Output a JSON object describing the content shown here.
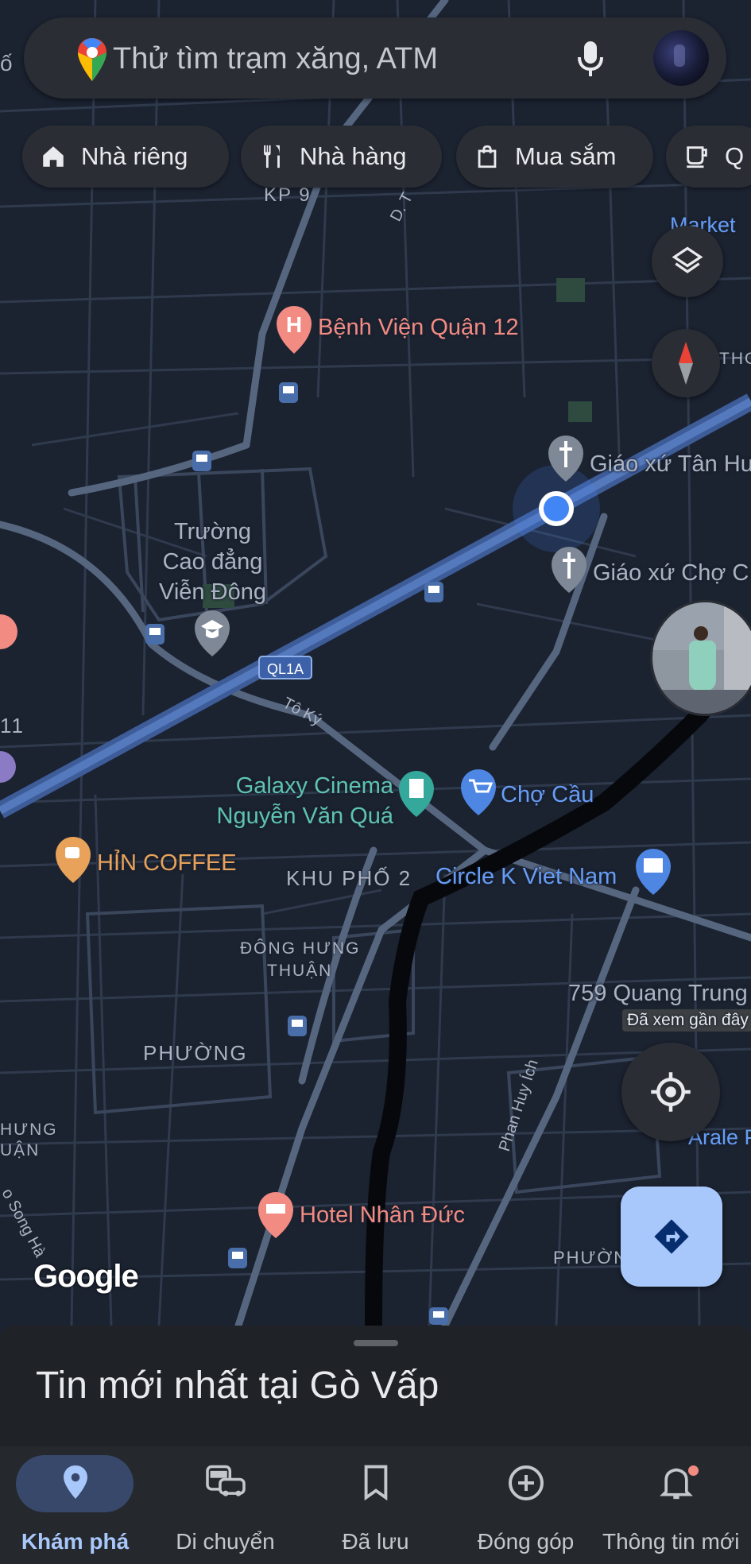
{
  "search": {
    "placeholder": "Thử tìm trạm xăng, ATM"
  },
  "chips": [
    {
      "label": "Nhà riêng",
      "icon": "home-icon"
    },
    {
      "label": "Nhà hàng",
      "icon": "restaurant-icon"
    },
    {
      "label": "Mua sắm",
      "icon": "shopping-bag-icon"
    },
    {
      "label": "Q",
      "icon": "coffee-icon"
    }
  ],
  "map": {
    "pois": [
      {
        "name": "Bệnh Viện Quận 12",
        "color": "#f28b82"
      },
      {
        "name": "Giáo xứ Tân Hu",
        "color": "#aab3c2"
      },
      {
        "name": "Giáo xứ Chợ C",
        "color": "#aab3c2"
      },
      {
        "name": "Trường Cao đẳng Viễn Đông",
        "lines": [
          "Trường",
          "Cao đẳng",
          "Viễn Đông"
        ],
        "color": "#aab3c2"
      },
      {
        "name": "Galaxy Cinema Nguyễn Văn Quá",
        "lines": [
          "Galaxy Cinema",
          "Nguyễn Văn Quá"
        ],
        "color": "#5ec3b0"
      },
      {
        "name": "Chợ Cầu",
        "color": "#669df6"
      },
      {
        "name": "HỈN COFFEE",
        "color": "#e8a25a"
      },
      {
        "name": "Circle K Viet Nam",
        "color": "#669df6"
      },
      {
        "name": "759 Quang Trung",
        "color": "#aab3c2"
      },
      {
        "name": "Hotel Nhân Đức",
        "color": "#f28b82"
      },
      {
        "name": "Market",
        "color": "#669df6"
      },
      {
        "name": "Arale Pe",
        "color": "#669df6"
      }
    ],
    "areas": [
      "KP 9",
      "KHU PHỐ 2",
      "ĐÔNG HƯNG",
      "THUẬN",
      "PHƯỜNG",
      "PHƯỜN",
      "HƯNG",
      "UẬN",
      "THO"
    ],
    "roads": [
      "QL1A",
      "Tô Ký",
      "Phan Huy Ích",
      "D. T",
      "o Song Hà"
    ],
    "recently_viewed": "Đã xem gần đây",
    "edge_labels": [
      "ố",
      "11"
    ],
    "google_logo": "Google"
  },
  "sheet": {
    "title": "Tin mới nhất tại Gò Vấp"
  },
  "nav": [
    {
      "label": "Khám phá",
      "icon": "location-pin-icon",
      "active": true
    },
    {
      "label": "Di chuyển",
      "icon": "commute-icon",
      "active": false
    },
    {
      "label": "Đã lưu",
      "icon": "bookmark-icon",
      "active": false
    },
    {
      "label": "Đóng góp",
      "icon": "add-circle-icon",
      "active": false
    },
    {
      "label": "Thông tin mới",
      "icon": "bell-icon",
      "active": false
    }
  ],
  "colors": {
    "accent": "#8ab4f8",
    "active_pill": "#37486a",
    "directions_fab": "#a8c7fa",
    "highway": "#4b6aa6",
    "location_dot": "#4285f4"
  }
}
